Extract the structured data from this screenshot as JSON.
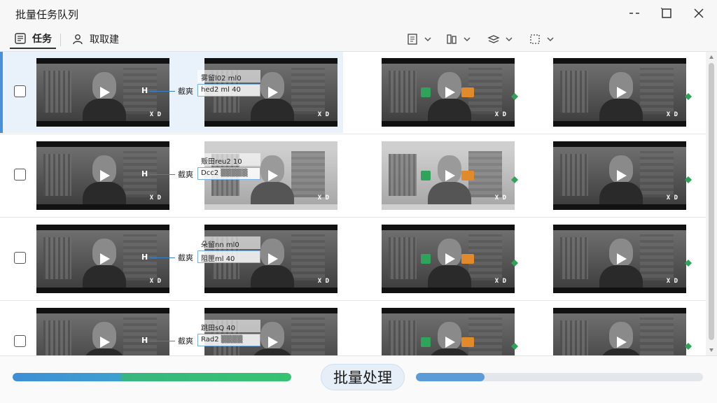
{
  "window": {
    "title": "批量任务队列"
  },
  "toolbar": {
    "tabs": [
      {
        "label": "任务",
        "icon": "task-list-icon",
        "active": true
      },
      {
        "label": "取取建",
        "icon": "user-icon",
        "active": false
      }
    ],
    "buttons": [
      {
        "icon": "document-icon"
      },
      {
        "icon": "columns-icon"
      },
      {
        "icon": "layers-icon"
      },
      {
        "icon": "dotted-square-icon"
      }
    ]
  },
  "rows": [
    {
      "selected": true,
      "cut_label": "截爽",
      "clip_top": "雾留l02 ml0",
      "clip_bottom": "hed2 ml 40",
      "hd": "X D"
    },
    {
      "selected": false,
      "cut_label": "截爽",
      "clip_top": "贩田reu2 10",
      "clip_bottom": "Dcc2 ▒▒▒▒▒",
      "hd": "X D"
    },
    {
      "selected": false,
      "cut_label": "截爽",
      "clip_top": "朵留nn ml0",
      "clip_bottom": "阻匣ml 40",
      "hd": "X D"
    },
    {
      "selected": false,
      "cut_label": "截爽",
      "clip_top": "跳田sQ 40",
      "clip_bottom": "Rad2 ▒▒▒▒",
      "hd": "X D"
    }
  ],
  "footer": {
    "button_label": "批量处理",
    "left_progress": 1.0,
    "right_progress": 0.24
  },
  "colors": {
    "accent": "#3d8fd6",
    "success": "#36c470",
    "tag_green": "#2fa35a",
    "tag_orange": "#e08a2a"
  }
}
